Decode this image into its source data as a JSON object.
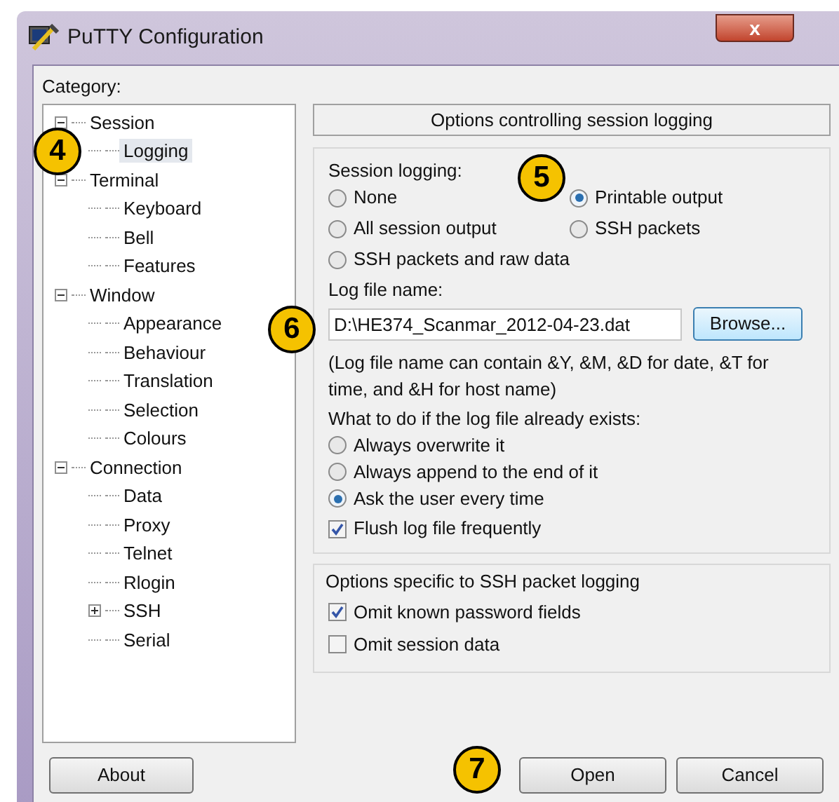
{
  "window": {
    "title": "PuTTY Configuration",
    "close_label": "x"
  },
  "category_label": "Category:",
  "tree": [
    {
      "label": "Session",
      "expanded": true,
      "selected": false,
      "children": [
        {
          "label": "Logging",
          "selected": true
        }
      ]
    },
    {
      "label": "Terminal",
      "expanded": true,
      "selected": false,
      "children": [
        {
          "label": "Keyboard",
          "selected": false
        },
        {
          "label": "Bell",
          "selected": false
        },
        {
          "label": "Features",
          "selected": false
        }
      ]
    },
    {
      "label": "Window",
      "expanded": true,
      "selected": false,
      "children": [
        {
          "label": "Appearance",
          "selected": false
        },
        {
          "label": "Behaviour",
          "selected": false
        },
        {
          "label": "Translation",
          "selected": false
        },
        {
          "label": "Selection",
          "selected": false
        },
        {
          "label": "Colours",
          "selected": false
        }
      ]
    },
    {
      "label": "Connection",
      "expanded": true,
      "selected": false,
      "children": [
        {
          "label": "Data",
          "selected": false
        },
        {
          "label": "Proxy",
          "selected": false
        },
        {
          "label": "Telnet",
          "selected": false
        },
        {
          "label": "Rlogin",
          "selected": false
        },
        {
          "label": "SSH",
          "expanded": false,
          "selected": false
        },
        {
          "label": "Serial",
          "selected": false
        }
      ]
    }
  ],
  "panel_header": "Options controlling session logging",
  "session_logging": {
    "label": "Session logging:",
    "options": [
      {
        "label": "None",
        "selected": false
      },
      {
        "label": "Printable output",
        "selected": true
      },
      {
        "label": "All session output",
        "selected": false
      },
      {
        "label": "SSH packets",
        "selected": false
      },
      {
        "label": "SSH packets and raw data",
        "selected": false
      }
    ]
  },
  "log_file": {
    "label": "Log file name:",
    "value": "D:\\HE374_Scanmar_2012-04-23.dat",
    "browse": "Browse..."
  },
  "log_note": "(Log file name can contain &Y, &M, &D for date, &T for time, and &H for host name)",
  "exists": {
    "label": "What to do if the log file already exists:",
    "options": [
      {
        "label": "Always overwrite it",
        "selected": false
      },
      {
        "label": "Always append to the end of it",
        "selected": false
      },
      {
        "label": "Ask the user every time",
        "selected": true
      }
    ]
  },
  "flush": {
    "label": "Flush log file frequently",
    "checked": true
  },
  "ssh_group": {
    "title": "Options specific to SSH packet logging",
    "options": [
      {
        "label": "Omit known password fields",
        "checked": true
      },
      {
        "label": "Omit session data",
        "checked": false
      }
    ]
  },
  "buttons": {
    "about": "About",
    "open": "Open",
    "cancel": "Cancel"
  },
  "callouts": [
    "4",
    "5",
    "6",
    "7"
  ]
}
